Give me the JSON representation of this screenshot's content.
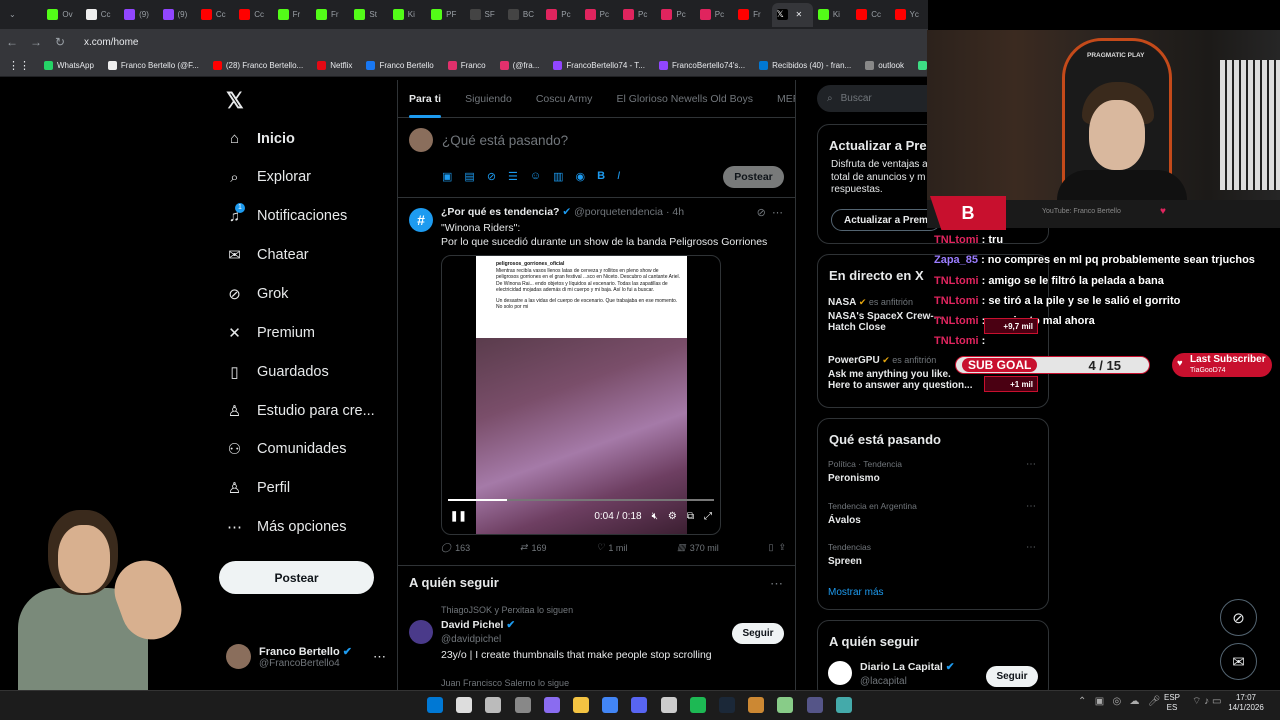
{
  "browser": {
    "tabs": [
      {
        "label": "Ov",
        "color": "#53fc18"
      },
      {
        "label": "Cc",
        "color": "#eee"
      },
      {
        "label": "(9)",
        "color": "#9146ff"
      },
      {
        "label": "(9)",
        "color": "#9146ff"
      },
      {
        "label": "Cc",
        "color": "#ff0000"
      },
      {
        "label": "Cc",
        "color": "#ff0000"
      },
      {
        "label": "Fr",
        "color": "#53fc18"
      },
      {
        "label": "Fr",
        "color": "#53fc18"
      },
      {
        "label": "St",
        "color": "#53fc18"
      },
      {
        "label": "Ki",
        "color": "#53fc18"
      },
      {
        "label": "PF",
        "color": "#53fc18"
      },
      {
        "label": "SF",
        "color": "#444"
      },
      {
        "label": "BC",
        "color": "#444"
      },
      {
        "label": "Pc",
        "color": "#e0245e"
      },
      {
        "label": "Pc",
        "color": "#e0245e"
      },
      {
        "label": "Pc",
        "color": "#e0245e"
      },
      {
        "label": "Pc",
        "color": "#e0245e"
      },
      {
        "label": "Pc",
        "color": "#e0245e"
      },
      {
        "label": "Fr",
        "color": "#ff0000"
      }
    ],
    "active_tab": {
      "label": "X"
    },
    "after_tabs": [
      {
        "label": "Ki",
        "color": "#53fc18"
      },
      {
        "label": "Cc",
        "color": "#ff0000"
      },
      {
        "label": "Yc",
        "color": "#ff0000"
      }
    ],
    "url": "x.com/home",
    "bookmarks": [
      {
        "label": "WhatsApp",
        "color": "#25d366"
      },
      {
        "label": "Franco Bertello (@F...",
        "color": "#eee"
      },
      {
        "label": "(28) Franco Bertello...",
        "color": "#ff0000"
      },
      {
        "label": "Netflix",
        "color": "#e50914"
      },
      {
        "label": "Franco Bertello",
        "color": "#1877f2"
      },
      {
        "label": "Franco",
        "color": "#e1306c"
      },
      {
        "label": "(@fra...",
        "color": "#e1306c"
      },
      {
        "label": "FrancoBertello74 - T...",
        "color": "#9146ff"
      },
      {
        "label": "FrancoBertello74's...",
        "color": "#9146ff"
      },
      {
        "label": "Recibidos (40) - fran...",
        "color": "#0078d4"
      },
      {
        "label": "outlook",
        "color": "#888"
      },
      {
        "label": "Aler",
        "color": "#3ddc84"
      }
    ]
  },
  "leftnav": {
    "items": [
      {
        "label": "Inicio",
        "icon": "home-icon",
        "glyph": "⌂"
      },
      {
        "label": "Explorar",
        "icon": "search-icon",
        "glyph": "⌕"
      },
      {
        "label": "Notificaciones",
        "icon": "bell-icon",
        "glyph": "♫",
        "badge": "1"
      },
      {
        "label": "Chatear",
        "icon": "mail-icon",
        "glyph": "✉"
      },
      {
        "label": "Grok",
        "icon": "grok-icon",
        "glyph": "⊘"
      },
      {
        "label": "Premium",
        "icon": "x-premium-icon",
        "glyph": "✕"
      },
      {
        "label": "Guardados",
        "icon": "bookmark-icon",
        "glyph": "▯"
      },
      {
        "label": "Estudio para cre...",
        "icon": "studio-icon",
        "glyph": "♙"
      },
      {
        "label": "Comunidades",
        "icon": "communities-icon",
        "glyph": "⚇"
      },
      {
        "label": "Perfil",
        "icon": "profile-icon",
        "glyph": "♙"
      },
      {
        "label": "Más opciones",
        "icon": "more-icon",
        "glyph": "⋯"
      }
    ],
    "post_label": "Postear",
    "profile": {
      "name": "Franco Bertello",
      "handle": "@FrancoBertello4"
    }
  },
  "feed": {
    "tabs": [
      "Para ti",
      "Siguiendo",
      "Coscu Army",
      "El Glorioso Newells Old Boys",
      "MERNO"
    ],
    "compose_placeholder": "¿Qué está pasando?",
    "compose_post": "Postear",
    "tweet": {
      "name": "¿Por qué es tendencia?",
      "handle": "@porquetendencia",
      "time": "· 4h",
      "line1": "\"Winona Riders\":",
      "line2": "Por lo que sucedió durante un show de la banda Peligrosos Gorriones",
      "shot_user": "peligrosos_gorriones_oficial",
      "shot_text": "Mientras recibía vasos llenos latas de cerveza y rollitos en pleno show de peligrosos gorriones en el gran festival ...sco en Niceto. Descubro al cantante Ariel. De Winona Rai... endo objetos y líquidos al escenario. Todas las zapatillas de electricidad mojadas además di mi cuerpo y mi baja. Así lo fui a buscar.",
      "shot_text2": "Un desastre a las vidas del cuerpo de escenario. Que trabajaba en ese momento. No solo por mi",
      "video_time": "0:04 / 0:18",
      "video_progress": 0.22,
      "replies": "163",
      "reposts": "169",
      "likes": "1 mil",
      "views": "370 mil"
    },
    "who_to_follow": {
      "title": "A quién seguir",
      "people": [
        {
          "note": "ThiagoJSOK y Perxitaa lo siguen",
          "name": "David Pichel",
          "handle": "@davidpichel",
          "bio": "23y/o | I create thumbnails that make people stop scrolling",
          "follow": "Seguir"
        },
        {
          "note": "Juan Francisco Salerno lo sigue"
        }
      ]
    }
  },
  "sidebar": {
    "search_placeholder": "Buscar",
    "premium": {
      "title": "Actualizar a Pre",
      "text": [
        "Disfruta de ventajas a",
        "total de anuncios y m",
        "respuestas."
      ],
      "button": "Actualizar a Prem"
    },
    "live": {
      "title": "En directo en X",
      "items": [
        {
          "host": "NASA",
          "role": "es anfitrión",
          "title": "NASA's SpaceX Crew-...",
          "title2": "Hatch Close"
        },
        {
          "host": "PowerGPU",
          "role": "es anfitrión",
          "title": "Ask me anything you like.",
          "title2": "Here to answer any question..."
        }
      ]
    },
    "trends": {
      "title": "Qué está pasando",
      "items": [
        {
          "category": "Política · Tendencia",
          "name": "Peronismo"
        },
        {
          "category": "Tendencia en Argentina",
          "name": "Ávalos"
        },
        {
          "category": "Tendencias",
          "name": "Spreen"
        }
      ],
      "show_more": "Mostrar más"
    },
    "follow_title": "A quién seguir",
    "follow": {
      "name": "Diario La Capital",
      "handle": "@lacapital",
      "button": "Seguir"
    }
  },
  "overlay": {
    "cam_brand": "PRAGMATIC PLAY",
    "channel": "YouTube: Franco Bertello",
    "chat": [
      {
        "user": "TNLtomi",
        "msg": "tru"
      },
      {
        "user": "Zapa_85",
        "msg": "no compres en ml pq probablemente sean trjuchos"
      },
      {
        "user": "TNLtomi",
        "msg": "amigo se le filtró la pelada a bana"
      },
      {
        "user": "TNLtomi",
        "msg": "se tiró a la pile y se le salió el gorrito"
      },
      {
        "user": "TNLtomi",
        "msg": "me siento mal ahora"
      },
      {
        "user": "TNLtomi",
        "msg": ""
      }
    ],
    "sub_tags": [
      "+9,7 mil",
      "+1 mil"
    ],
    "sub_goal": {
      "label": "SUB GOAL",
      "value": "4 / 15"
    },
    "last_sub": {
      "title": "Last Subscriber",
      "name": "TiaGooD74"
    }
  },
  "taskbar": {
    "lang1": "ESP",
    "lang2": "ES",
    "time": "17:07",
    "date": "14/1/2026",
    "icons": [
      {
        "name": "windows-icon",
        "color": "#0078d4"
      },
      {
        "name": "search-icon",
        "color": "#ddd"
      },
      {
        "name": "taskview-icon",
        "color": "#bbb"
      },
      {
        "name": "store-icon",
        "color": "#888"
      },
      {
        "name": "app-icon",
        "color": "#8a6cf0"
      },
      {
        "name": "explorer-icon",
        "color": "#f3c342"
      },
      {
        "name": "chrome-icon",
        "color": "#4285f4"
      },
      {
        "name": "discord-icon",
        "color": "#5865f2"
      },
      {
        "name": "obs-icon",
        "color": "#ccc"
      },
      {
        "name": "spotify-icon",
        "color": "#1db954"
      },
      {
        "name": "steam-icon",
        "color": "#1b2838"
      },
      {
        "name": "app2-icon",
        "color": "#c83"
      },
      {
        "name": "app3-icon",
        "color": "#8c8"
      },
      {
        "name": "app4-icon",
        "color": "#558"
      },
      {
        "name": "app5-icon",
        "color": "#4aa"
      }
    ]
  }
}
